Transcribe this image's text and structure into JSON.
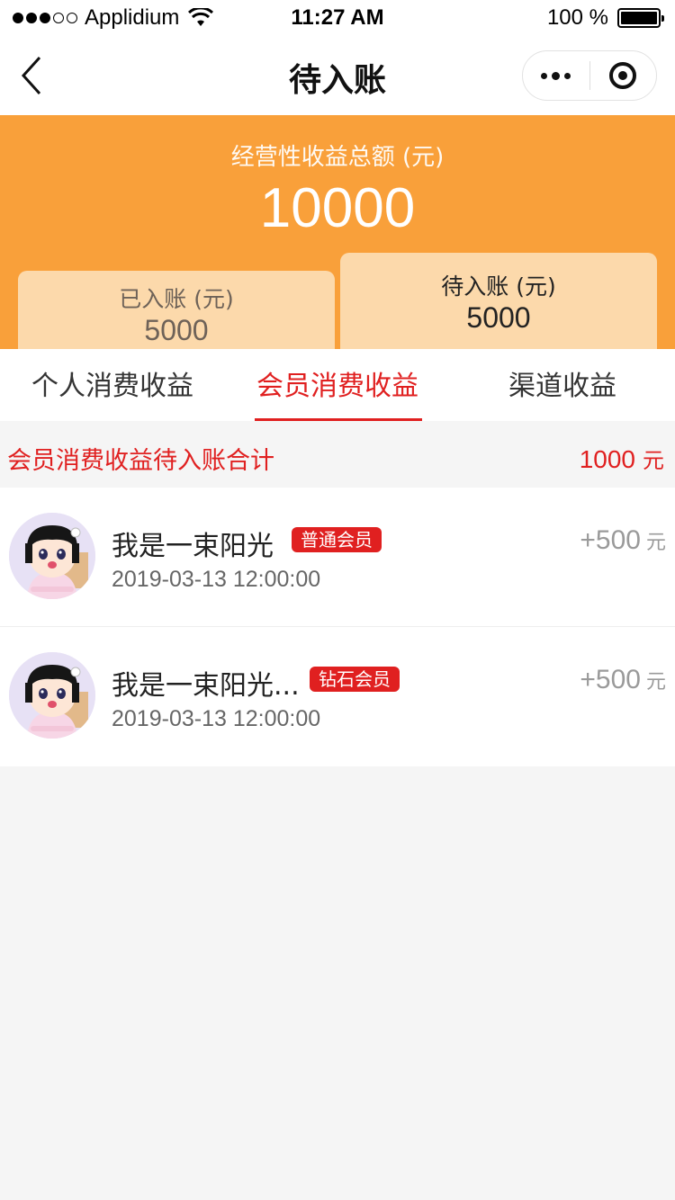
{
  "status_bar": {
    "carrier": "Applidium",
    "time": "11:27 AM",
    "battery": "100 %"
  },
  "nav": {
    "title": "待入账"
  },
  "hero": {
    "label": "经营性收益总额 (元)",
    "amount": "10000",
    "received_label": "已入账 (元)",
    "received_value": "5000",
    "pending_label": "待入账 (元)",
    "pending_value": "5000",
    "color": "#f9a03a"
  },
  "tabs": [
    {
      "label": "个人消费收益"
    },
    {
      "label": "会员消费收益"
    },
    {
      "label": "渠道收益"
    }
  ],
  "summary": {
    "label": "会员消费收益待入账合计",
    "value": "1000",
    "unit": "元"
  },
  "items": [
    {
      "name": "我是一束阳光",
      "badge": "普通会员",
      "time": "2019-03-13 12:00:00",
      "amount": "+500",
      "unit": "元"
    },
    {
      "name": "我是一束阳光...",
      "badge": "钻石会员",
      "time": "2019-03-13 12:00:00",
      "amount": "+500",
      "unit": "元"
    }
  ],
  "accent_color": "#e02020"
}
